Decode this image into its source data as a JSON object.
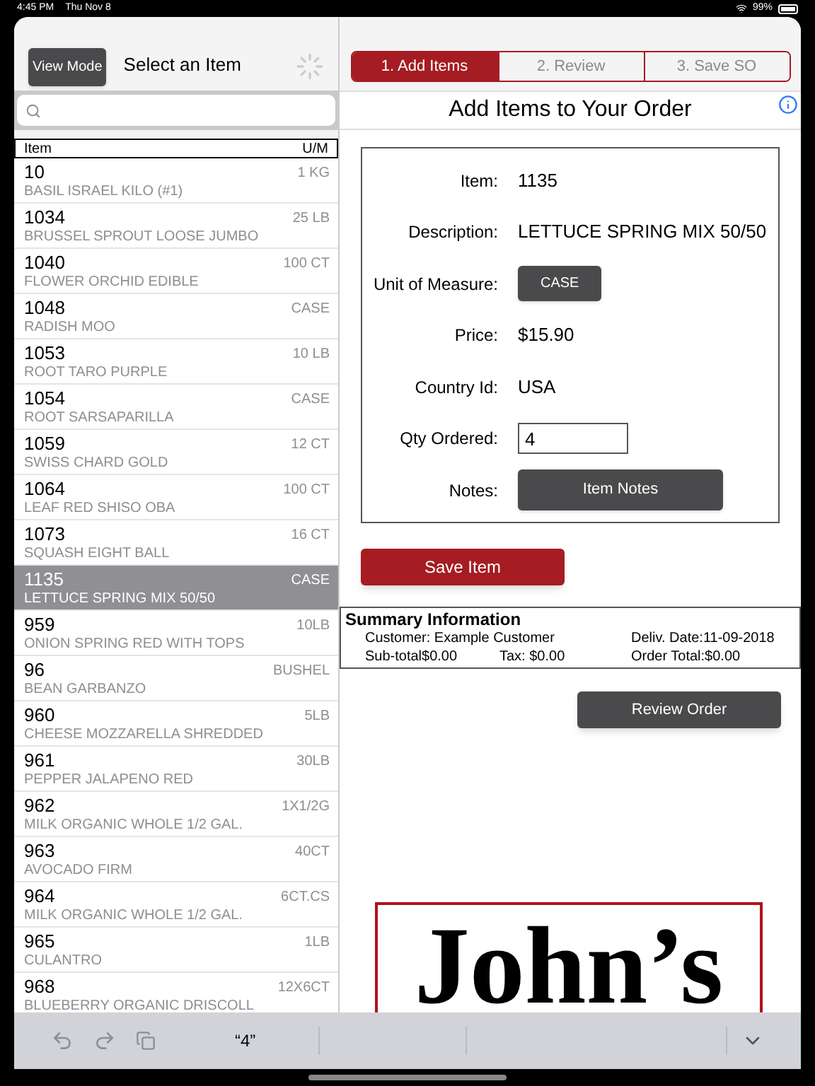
{
  "status_bar": {
    "time": "4:45 PM",
    "date": "Thu Nov 8",
    "battery": "99%"
  },
  "left_header": {
    "mode_button": "View Mode",
    "title": "Select an Item"
  },
  "list_columns": [
    "Item",
    "U/M"
  ],
  "items": [
    {
      "code": "10",
      "um": "1 KG",
      "description": "BASIL ISRAEL KILO (#1)",
      "selected": false
    },
    {
      "code": "1034",
      "um": "25 LB",
      "description": "BRUSSEL SPROUT LOOSE JUMBO",
      "selected": false
    },
    {
      "code": "1040",
      "um": "100 CT",
      "description": "FLOWER ORCHID EDIBLE",
      "selected": false
    },
    {
      "code": "1048",
      "um": "CASE",
      "description": "RADISH MOO",
      "selected": false
    },
    {
      "code": "1053",
      "um": "10 LB",
      "description": "ROOT TARO PURPLE",
      "selected": false
    },
    {
      "code": "1054",
      "um": "CASE",
      "description": "ROOT SARSAPARILLA",
      "selected": false
    },
    {
      "code": "1059",
      "um": "12 CT",
      "description": "SWISS CHARD GOLD",
      "selected": false
    },
    {
      "code": "1064",
      "um": "100 CT",
      "description": "LEAF RED SHISO OBA",
      "selected": false
    },
    {
      "code": "1073",
      "um": "16 CT",
      "description": "SQUASH EIGHT BALL",
      "selected": false
    },
    {
      "code": "1135",
      "um": "CASE",
      "description": "LETTUCE SPRING MIX 50/50",
      "selected": true
    },
    {
      "code": "959",
      "um": "10LB",
      "description": "ONION SPRING RED WITH TOPS",
      "selected": false
    },
    {
      "code": "96",
      "um": "BUSHEL",
      "description": "BEAN GARBANZO",
      "selected": false
    },
    {
      "code": "960",
      "um": "5LB",
      "description": "CHEESE MOZZARELLA SHREDDED",
      "selected": false
    },
    {
      "code": "961",
      "um": "30LB",
      "description": "PEPPER JALAPENO RED",
      "selected": false
    },
    {
      "code": "962",
      "um": "1X1/2G",
      "description": "MILK ORGANIC WHOLE 1/2 GAL.",
      "selected": false
    },
    {
      "code": "963",
      "um": "40CT",
      "description": "AVOCADO FIRM",
      "selected": false
    },
    {
      "code": "964",
      "um": "6CT.CS",
      "description": "MILK ORGANIC WHOLE 1/2 GAL.",
      "selected": false
    },
    {
      "code": "965",
      "um": "1LB",
      "description": "CULANTRO",
      "selected": false
    },
    {
      "code": "968",
      "um": "12X6CT",
      "description": "BLUEBERRY ORGANIC  DRISCOLL",
      "selected": false
    }
  ],
  "steps": [
    {
      "label": "1. Add Items",
      "selected": true
    },
    {
      "label": "2. Review",
      "selected": false
    },
    {
      "label": "3. Save SO",
      "selected": false
    }
  ],
  "form_title": "Add Items to Your Order",
  "form": [
    {
      "kind": "text",
      "label": "Item:",
      "value": "1135"
    },
    {
      "kind": "text",
      "label": "Description:",
      "value": "LETTUCE SPRING MIX 50/50"
    },
    {
      "kind": "chip",
      "label": "Unit of Measure:",
      "value": "CASE"
    },
    {
      "kind": "text",
      "label": "Price:",
      "value": "$15.90"
    },
    {
      "kind": "text",
      "label": "Country Id:",
      "value": "USA"
    },
    {
      "kind": "input",
      "label": "Qty Ordered:",
      "value": "4"
    },
    {
      "kind": "button",
      "label": "Notes:",
      "value": "Item Notes"
    }
  ],
  "save_button": "Save Item",
  "summary": {
    "title": "Summary Information",
    "customer": "Customer: Example Customer",
    "delivery": "Deliv. Date:11-09-2018",
    "subtotal": "Sub-total$0.00",
    "tax": "Tax: $0.00",
    "total": "Order Total:$0.00"
  },
  "review_button": "Review Order",
  "logo": "John’s",
  "keyboard_bar": {
    "suggestion": "“4”"
  }
}
